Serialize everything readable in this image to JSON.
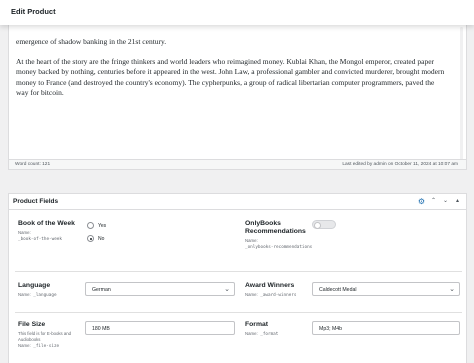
{
  "header": {
    "title": "Edit Product"
  },
  "editor": {
    "line_partial": "emergence of shadow banking in the 21st century.",
    "paragraph": "At the heart of the story are the fringe thinkers and world leaders who reimagined money. Kublai Khan, the Mongol emperor, created paper money backed by nothing, centuries before it appeared in the west. John Law, a professional gambler and convicted murderer, brought modern money to France (and destroyed the country's economy). The cypherpunks, a group of radical libertarian computer programmers, paved the way for bitcoin.",
    "word_count": "Word count: 121",
    "last_edited": "Last edited by admin on October 11, 2024 at 10:07 am"
  },
  "metabox": {
    "title": "Product Fields",
    "icons": [
      "gear-icon",
      "chevron-up-icon",
      "chevron-down-icon",
      "collapse-triangle-icon"
    ]
  },
  "fields": {
    "book_of_week": {
      "label": "Book of the Week",
      "name_key": "Name:",
      "name_val": "_book-of-the-week",
      "options": [
        "Yes",
        "No"
      ],
      "selected": "No"
    },
    "onlybooks": {
      "label": "OnlyBooks Recommendations",
      "name_key": "Name:",
      "name_val": "_onlybooks-recommendations",
      "enabled": false
    },
    "language": {
      "label": "Language",
      "name_key": "Name:",
      "name_val": "_language",
      "value": "German"
    },
    "award": {
      "label": "Award Winners",
      "name_key": "Name:",
      "name_val": "_award-winners",
      "value": "Caldecott Medal"
    },
    "file_size": {
      "label": "File Size",
      "note": "This field is for E-books and Audiobooks",
      "name_key": "Name:",
      "name_val": "_file-size",
      "value": "180 MB"
    },
    "format": {
      "label": "Format",
      "name_key": "Name:",
      "name_val": "_format",
      "value": "Mp3; M4b"
    }
  }
}
